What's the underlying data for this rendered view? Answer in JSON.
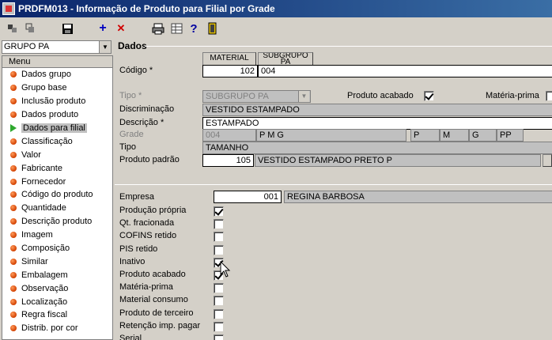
{
  "window": {
    "title": "PRDFM013 - Informação de Produto para Filial por Grade"
  },
  "toolbar": {
    "add": "+",
    "delete": "✕",
    "help": "?"
  },
  "left": {
    "combo_value": "GRUPO PA",
    "menu_header": "Menu",
    "items": [
      "Dados grupo",
      "Grupo base",
      "Inclusão produto",
      "Dados produto",
      "Dados para filial",
      "Classificação",
      "Valor",
      "Fabricante",
      "Fornecedor",
      "Código do produto",
      "Quantidade",
      "Descrição produto",
      "Imagem",
      "Composição",
      "Similar",
      "Embalagem",
      "Observação",
      "Localização",
      "Regra fiscal",
      "Distrib. por cor"
    ],
    "selected_index": 4
  },
  "dados": {
    "group_title": "Dados",
    "col_material": "MATERIAL",
    "col_subgrupo": "SUBGRUPO PA",
    "codigo_label": "Código *",
    "codigo_material": "102",
    "codigo_subgrupo": "004",
    "tipo_label": "Tipo *",
    "tipo_value": "SUBGRUPO PA",
    "produto_acabado_label": "Produto acabado",
    "produto_acabado_checked": true,
    "materia_prima_label": "Matéria-prima",
    "discriminacao_label": "Discriminação",
    "discriminacao_value": "VESTIDO ESTAMPADO",
    "descricao_label": "Descrição *",
    "descricao_value": "ESTAMPADO",
    "grade_label": "Grade",
    "grade_code": "004",
    "grade_name": "P M G",
    "grade_sizes": [
      "P",
      "M",
      "G",
      "PP"
    ],
    "tipo2_label": "Tipo",
    "tipo2_value": "TAMANHO",
    "produto_padrao_label": "Produto padrão",
    "produto_padrao_code": "105",
    "produto_padrao_desc": "VESTIDO ESTAMPADO PRETO P"
  },
  "filial": {
    "empresa_label": "Empresa",
    "empresa_code": "001",
    "empresa_name": "REGINA BARBOSA",
    "checks": [
      {
        "label": "Produção própria",
        "checked": true
      },
      {
        "label": "Qt. fracionada",
        "checked": false
      },
      {
        "label": "COFINS retido",
        "checked": false
      },
      {
        "label": "PIS retido",
        "checked": false
      },
      {
        "label": "Inativo",
        "checked": true
      },
      {
        "label": "Produto acabado",
        "checked": true
      },
      {
        "label": "Matéria-prima",
        "checked": false
      },
      {
        "label": "Material consumo",
        "checked": false
      },
      {
        "label": "Produto de terceiro",
        "checked": false
      },
      {
        "label": "Retenção imp. pagar",
        "checked": false
      },
      {
        "label": "Serial",
        "checked": false
      }
    ]
  }
}
